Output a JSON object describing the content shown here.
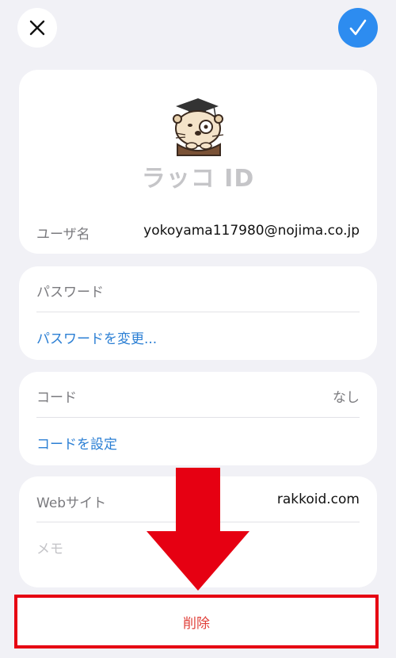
{
  "toolbar": {
    "close_icon": "close-icon",
    "done_icon": "checkmark-icon",
    "accent": "#2d8cf0"
  },
  "account": {
    "app_name": "ラッコ ID",
    "username_label": "ユーザ名",
    "username_value": "yokoyama117980@nojima.co.jp"
  },
  "password": {
    "label": "パスワード",
    "change_link": "パスワードを変更..."
  },
  "code": {
    "label": "コード",
    "value": "なし",
    "set_link": "コードを設定"
  },
  "details": {
    "website_label": "Webサイト",
    "website_value": "rakkoid.com",
    "memo_placeholder": "メモ"
  },
  "actions": {
    "delete_label": "削除",
    "highlight_color": "#e60012"
  }
}
